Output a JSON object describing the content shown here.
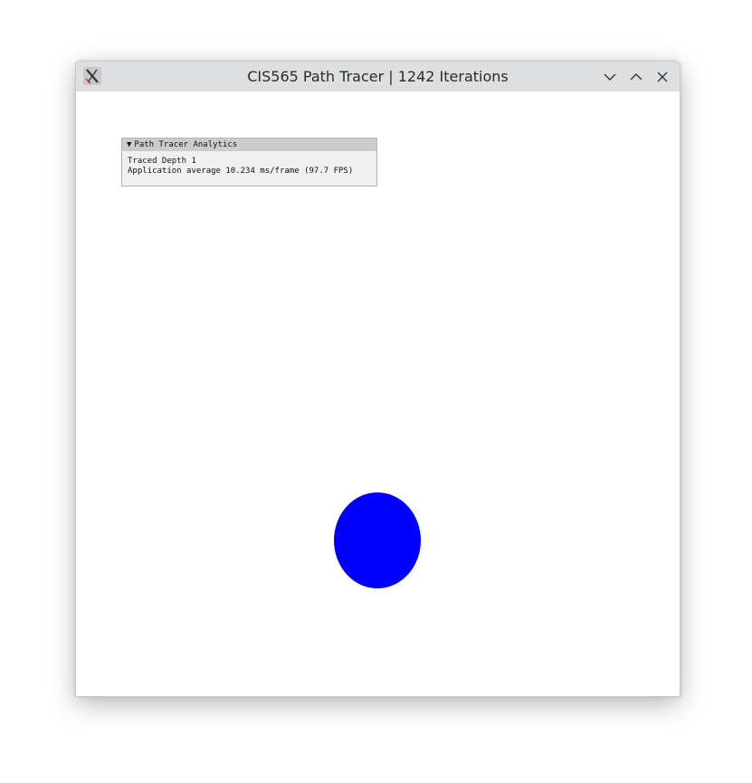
{
  "window": {
    "title": "CIS565 Path Tracer | 1242 Iterations",
    "app_icon": "x-logo-icon",
    "controls": [
      "minimize-icon",
      "maximize-icon",
      "close-icon"
    ]
  },
  "panel": {
    "arrow": "▼",
    "title": "Path Tracer Analytics",
    "lines": [
      "Traced Depth 1",
      "Application average 10.234 ms/frame (97.7 FPS)"
    ]
  },
  "scene": {
    "background_color": "#ffffff",
    "sphere_color": "#0000ff"
  }
}
